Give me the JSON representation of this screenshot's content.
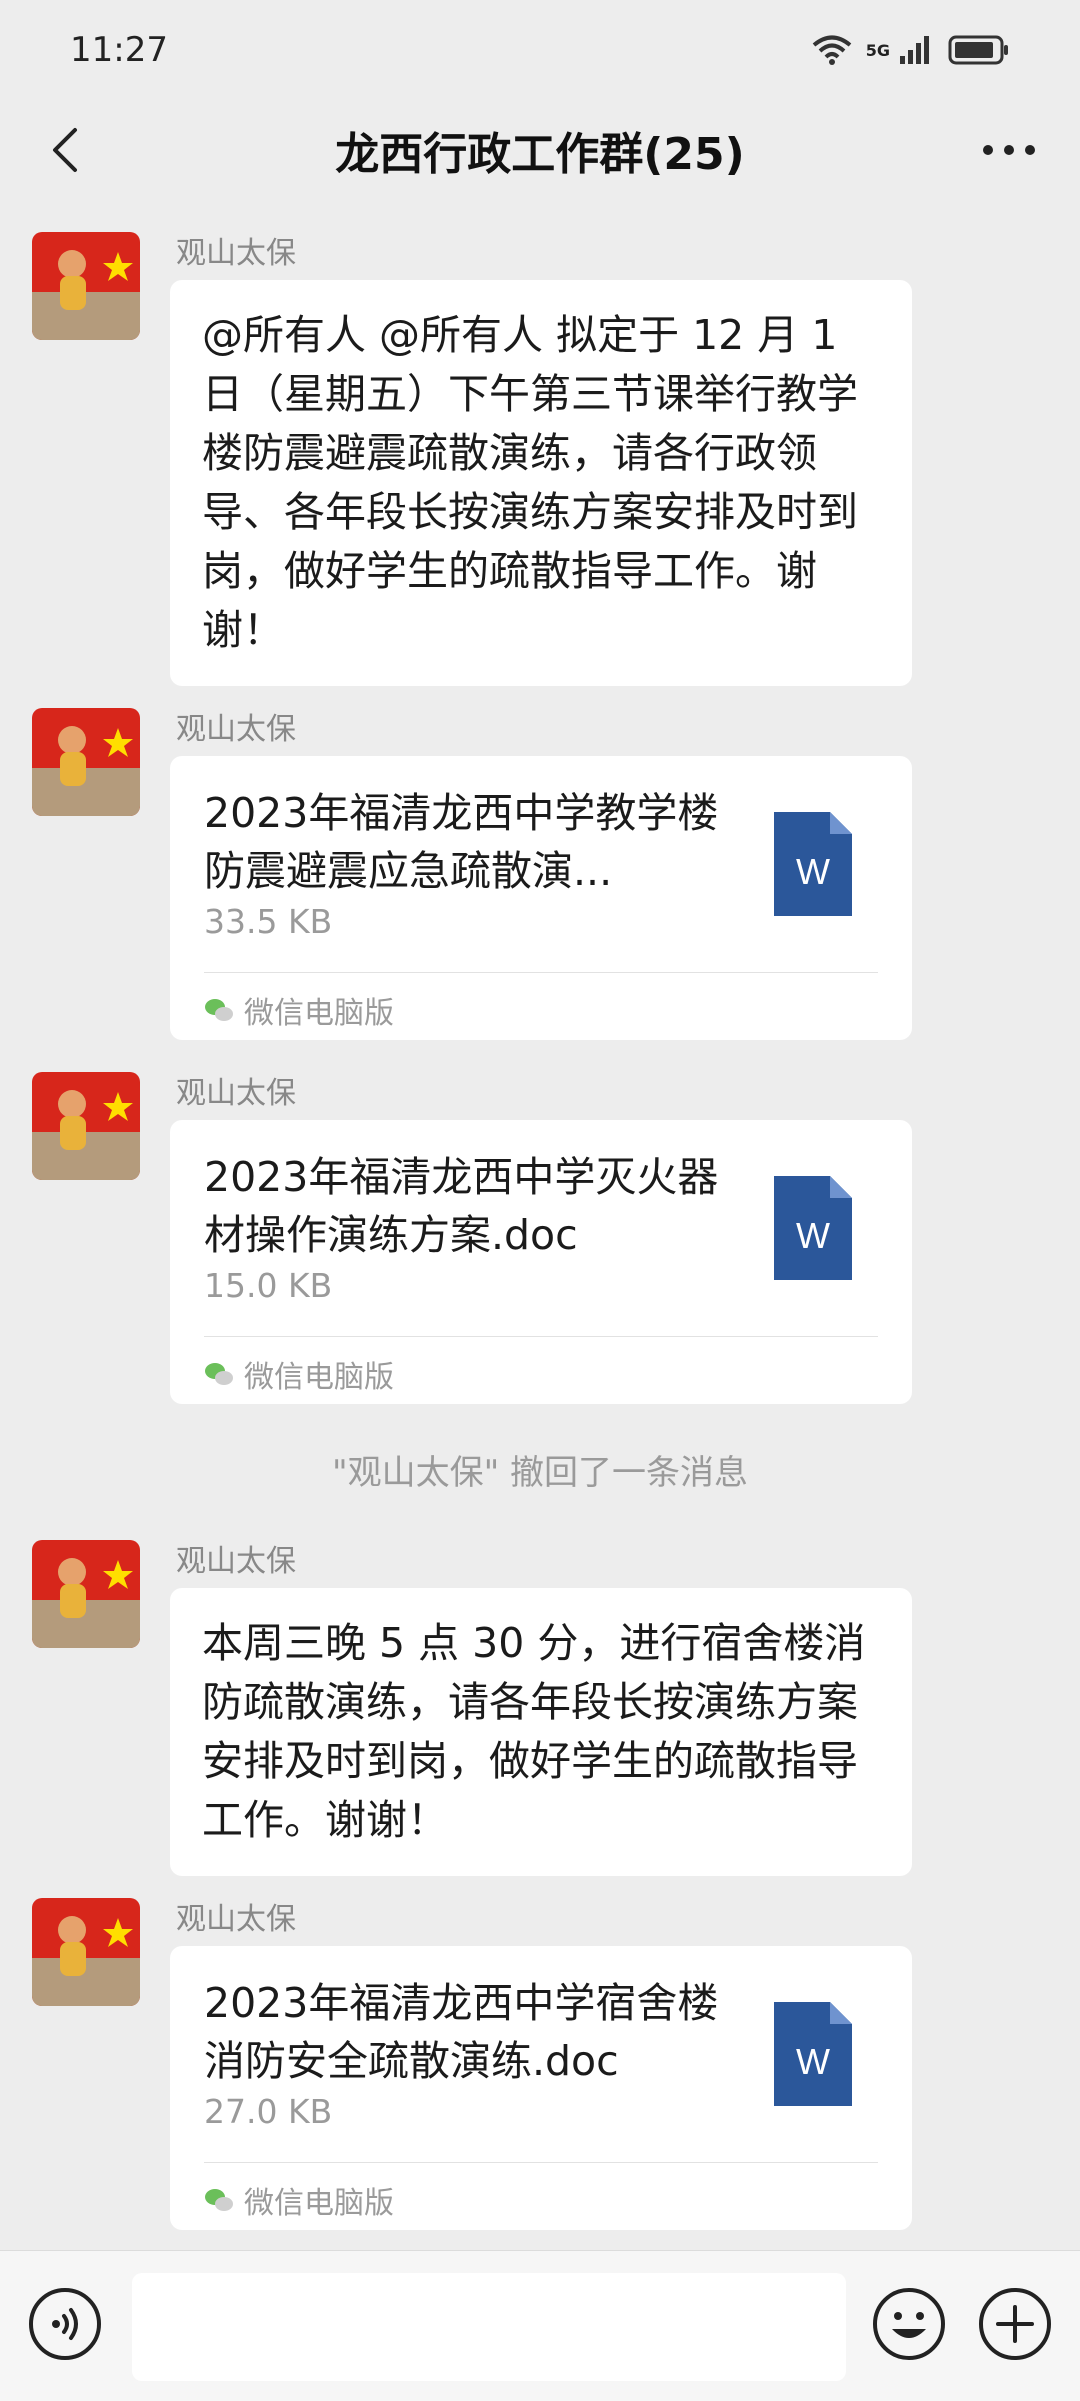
{
  "status": {
    "time": "11:27",
    "network": "5G"
  },
  "nav": {
    "title": "龙西行政工作群(25)"
  },
  "messages": [
    {
      "sender": "观山太保",
      "type": "text",
      "text": "@所有人  @所有人  拟定于 12 月 1 日（星期五）下午第三节课举行教学楼防震避震疏散演练，请各行政领导、各年段长按演练方案安排及时到岗，做好学生的疏散指导工作。谢谢！"
    },
    {
      "sender": "观山太保",
      "type": "file",
      "title": "2023年福清龙西中学教学楼防震避震应急疏散演...",
      "size": "33.5 KB",
      "source": "微信电脑版",
      "icon_letter": "W"
    },
    {
      "sender": "观山太保",
      "type": "file",
      "title": "2023年福清龙西中学灭火器材操作演练方案.doc",
      "size": "15.0 KB",
      "source": "微信电脑版",
      "icon_letter": "W"
    },
    {
      "sender": "观山太保",
      "type": "text",
      "text": "本周三晚 5 点 30 分，进行宿舍楼消防疏散演练，请各年段长按演练方案安排及时到岗，做好学生的疏散指导工作。谢谢！"
    },
    {
      "sender": "观山太保",
      "type": "file",
      "title": "2023年福清龙西中学宿舍楼消防安全疏散演练.doc",
      "size": "27.0 KB",
      "source": "微信电脑版",
      "icon_letter": "W"
    }
  ],
  "system_note": "\"观山太保\" 撤回了一条消息",
  "colors": {
    "word_icon": "#2b579a",
    "background": "#ededed",
    "bubble": "#ffffff",
    "flag_red": "#d7261b",
    "flag_star": "#ffde00"
  }
}
